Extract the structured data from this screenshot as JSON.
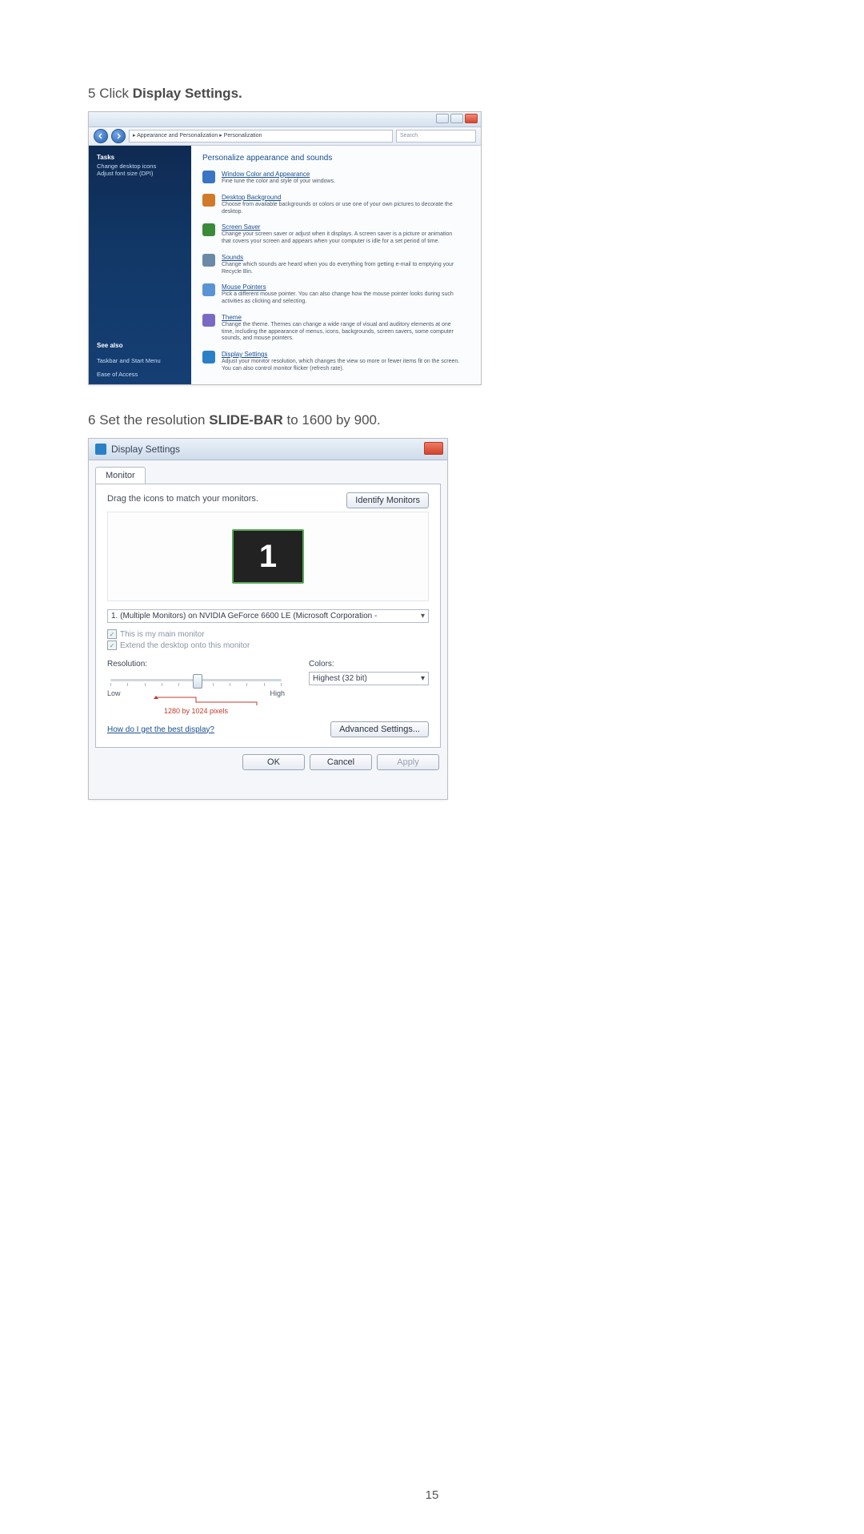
{
  "page_number": "15",
  "step5": {
    "n": "5",
    "prefix": "Click ",
    "bold": "Display Settings."
  },
  "step6": {
    "n": "6",
    "mid1": "Set the resolution ",
    "bold": "SLIDE-BAR",
    "mid2": " to 1600 by 900."
  },
  "personalization": {
    "breadcrumb": "▸ Appearance and Personalization ▸ Personalization",
    "search_placeholder": "Search",
    "sidebar": {
      "heading": "Tasks",
      "links": [
        "Change desktop icons",
        "Adjust font size (DPI)"
      ],
      "bottom": [
        "See also",
        "Taskbar and Start Menu",
        "Ease of Access"
      ]
    },
    "title": "Personalize appearance and sounds",
    "items": [
      {
        "icon": "#3a74c4",
        "name": "Window Color and Appearance",
        "desc": "Fine tune the color and style of your windows."
      },
      {
        "icon": "#d07a2a",
        "name": "Desktop Background",
        "desc": "Choose from available backgrounds or colors or use one of your own pictures to decorate the desktop."
      },
      {
        "icon": "#3a8a3a",
        "name": "Screen Saver",
        "desc": "Change your screen saver or adjust when it displays. A screen saver is a picture or animation that covers your screen and appears when your computer is idle for a set period of time."
      },
      {
        "icon": "#6a8aa8",
        "name": "Sounds",
        "desc": "Change which sounds are heard when you do everything from getting e-mail to emptying your Recycle Bin."
      },
      {
        "icon": "#5a94d4",
        "name": "Mouse Pointers",
        "desc": "Pick a different mouse pointer. You can also change how the mouse pointer looks during such activities as clicking and selecting."
      },
      {
        "icon": "#7a6ac4",
        "name": "Theme",
        "desc": "Change the theme. Themes can change a wide range of visual and auditory elements at one time, including the appearance of menus, icons, backgrounds, screen savers, some computer sounds, and mouse pointers."
      },
      {
        "icon": "#2a80c4",
        "name": "Display Settings",
        "desc": "Adjust your monitor resolution, which changes the view so more or fewer items fit on the screen. You can also control monitor flicker (refresh rate)."
      }
    ]
  },
  "display": {
    "title": "Display Settings",
    "tab": "Monitor",
    "instruct": "Drag the icons to match your monitors.",
    "identify": "Identify Monitors",
    "monitor_number": "1",
    "monitor_select": "1. (Multiple Monitors) on NVIDIA GeForce 6600 LE (Microsoft Corporation -",
    "check_main": "This is my main monitor",
    "check_extend": "Extend the desktop onto this monitor",
    "resolution_label": "Resolution:",
    "low": "Low",
    "high": "High",
    "marker": "1280 by 1024 pixels",
    "colors_label": "Colors:",
    "colors_value": "Highest (32 bit)",
    "help": "How do I get the best display?",
    "advanced": "Advanced Settings...",
    "ok": "OK",
    "cancel": "Cancel",
    "apply": "Apply"
  }
}
